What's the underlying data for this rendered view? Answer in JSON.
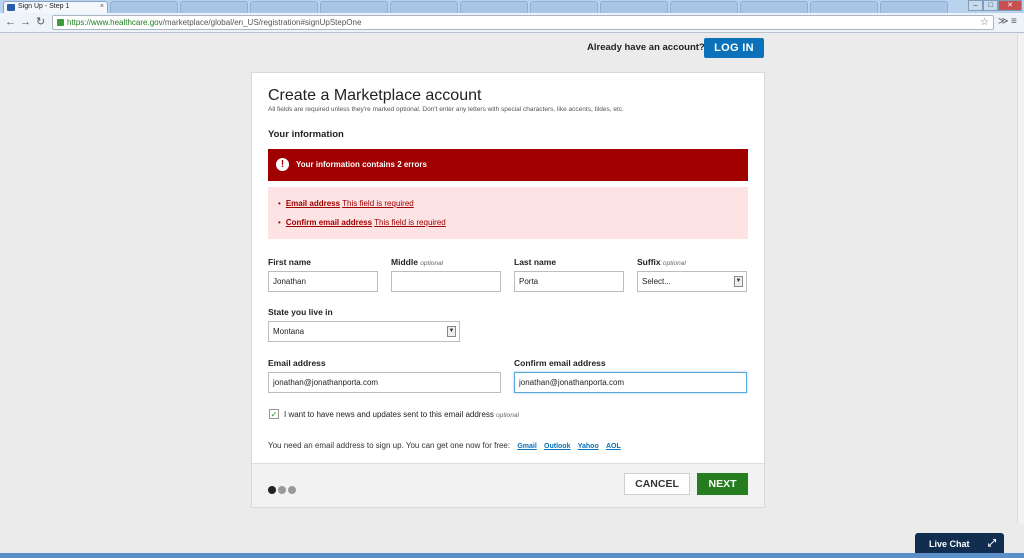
{
  "browser": {
    "active_tab_title": "Sign Up - Step 1",
    "url_scheme": "https://",
    "url_host": "www.healthcare.gov",
    "url_path": "/marketplace/global/en_US/registration#signUpStepOne",
    "tab_close": "×",
    "window_buttons": {
      "minimize": "‒",
      "maximize": "□",
      "close": "✕"
    },
    "nav": {
      "back": "←",
      "forward": "→",
      "reload": "↻",
      "star": "☆"
    }
  },
  "header": {
    "have_account_text": "Already have an account?",
    "login_label": "LOG IN"
  },
  "form": {
    "title": "Create a Marketplace account",
    "subtitle": "All fields are required unless they're marked optional. Don't enter any letters with special characters, like accents, tildes, etc.",
    "section_title": "Your information",
    "error_banner": "Your information contains 2 errors",
    "errors": [
      {
        "field": "Email address",
        "message": "This field is required"
      },
      {
        "field": "Confirm email address",
        "message": "This field is required"
      }
    ],
    "first_name": {
      "label": "First name",
      "value": "Jonathan"
    },
    "middle_name": {
      "label": "Middle",
      "optional": "optional",
      "value": ""
    },
    "last_name": {
      "label": "Last name",
      "value": "Porta"
    },
    "suffix": {
      "label": "Suffix",
      "optional": "optional",
      "value": "Select..."
    },
    "state": {
      "label": "State you live in",
      "value": "Montana"
    },
    "email": {
      "label": "Email address",
      "value": "jonathan@jonathanporta.com"
    },
    "confirm_email": {
      "label": "Confirm email address",
      "value": "jonathan@jonathanporta.com"
    },
    "newsletter": {
      "label": "I want to have news and updates sent to this email address",
      "optional": "optional",
      "checked": true
    },
    "free_email_text": "You need an email address to sign up. You can get one now for free:",
    "providers": [
      "Gmail",
      "Outlook",
      "Yahoo",
      "AOL"
    ],
    "cancel_label": "CANCEL",
    "next_label": "NEXT",
    "step_indicator": {
      "current": 1,
      "total": 3
    }
  },
  "live_chat": {
    "label": "Live Chat"
  },
  "colors": {
    "error": "#a00000",
    "error_bg": "#fde3e3",
    "primary": "#0b72b9",
    "next": "#267d1f",
    "chat": "#112e51"
  }
}
